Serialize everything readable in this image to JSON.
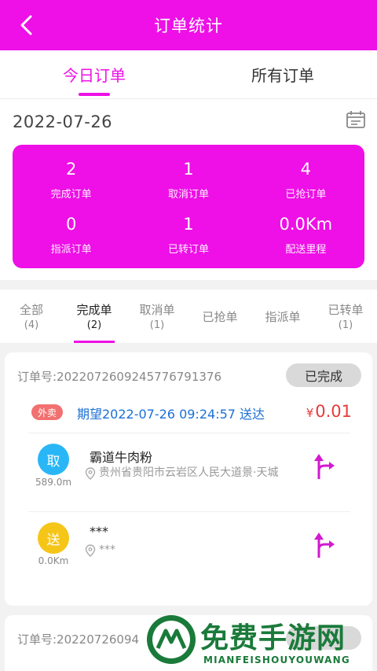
{
  "header": {
    "title": "订单统计",
    "back_icon": "chevron-left-icon"
  },
  "main_tabs": [
    {
      "label": "今日订单",
      "active": true
    },
    {
      "label": "所有订单",
      "active": false
    }
  ],
  "date": "2022-07-26",
  "stats": [
    {
      "value": "2",
      "label": "完成订单"
    },
    {
      "value": "1",
      "label": "取消订单"
    },
    {
      "value": "4",
      "label": "已抢订单"
    },
    {
      "value": "0",
      "label": "指派订单"
    },
    {
      "value": "1",
      "label": "已转订单"
    },
    {
      "value": "0.0Km",
      "label": "配送里程"
    }
  ],
  "sub_tabs": [
    {
      "label": "全部",
      "count": "(4)"
    },
    {
      "label": "完成单",
      "count": "(2)"
    },
    {
      "label": "取消单",
      "count": "(1)"
    },
    {
      "label": "已抢单",
      "count": ""
    },
    {
      "label": "指派单",
      "count": ""
    },
    {
      "label": "已转单",
      "count": "(1)"
    }
  ],
  "order": {
    "number": "订单号:20220726092457767913​76",
    "status": "已完成",
    "type": "外卖",
    "expected": "期望2022-07-26 09:24:57 送达",
    "currency": "¥",
    "price": "0.01",
    "pickup": {
      "badge": "取",
      "distance": "589.0m",
      "name": "霸道牛肉粉",
      "address": "贵州省贵阳市云岩区人民大道景·天城"
    },
    "delivery": {
      "badge": "送",
      "distance": "0.0Km",
      "name": "***",
      "address": "***"
    }
  },
  "order2": {
    "number": "订单号:20220726094"
  },
  "watermark": {
    "title": "免费手游网",
    "subtitle": "MIANFEISHOUYOUWANG"
  },
  "colors": {
    "brand": "#ee10e6",
    "link": "#1b6fd6",
    "price": "#e83a3a",
    "pick": "#29b6f6",
    "deliver": "#f5c518"
  }
}
